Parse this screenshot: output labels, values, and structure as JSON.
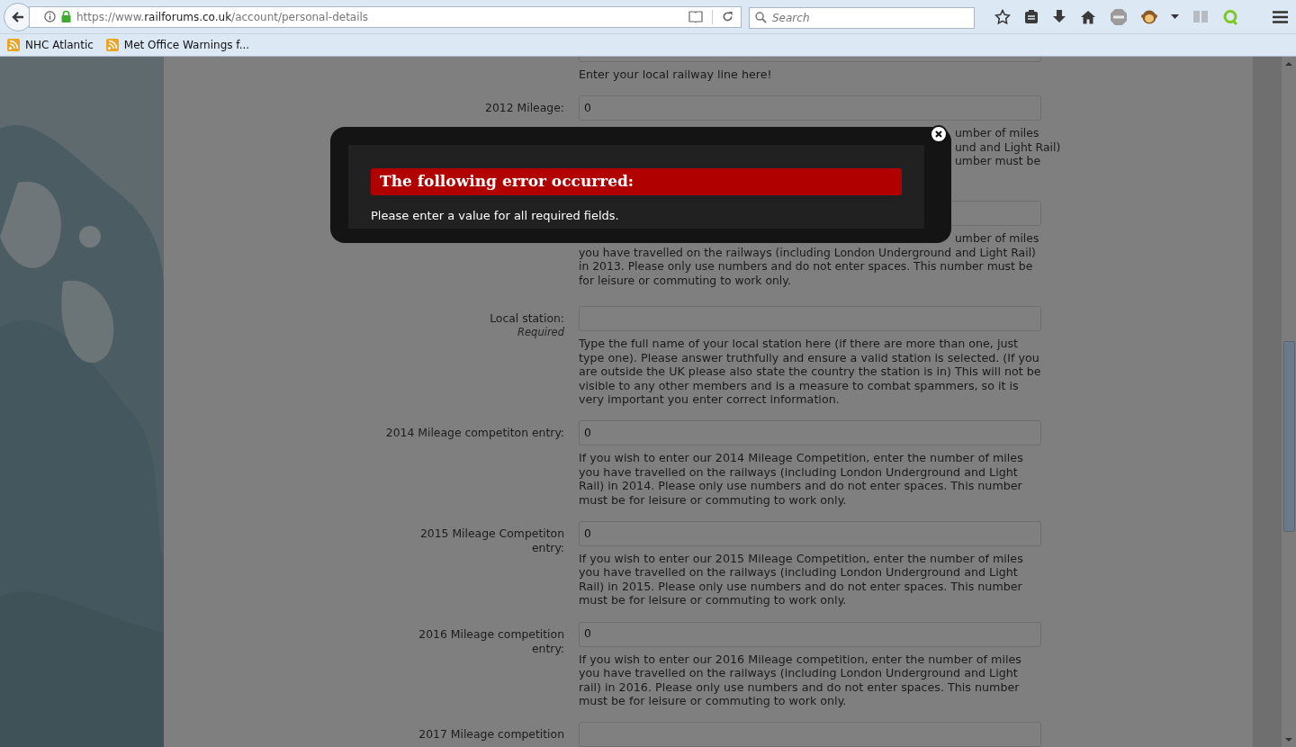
{
  "browser": {
    "url_scheme": "https://www.",
    "url_domain": "railforums.co.uk",
    "url_path": "/account/personal-details",
    "search_placeholder": "Search",
    "bookmarks": [
      {
        "label": "NHC Atlantic"
      },
      {
        "label": "Met Office Warnings f..."
      }
    ]
  },
  "form": {
    "rows": [
      {
        "help": "Enter your local railway line here!"
      },
      {
        "label": "2012 Mileage:",
        "value": "0",
        "help_lines": [
          {
            "kind": "tail",
            "text": "umber of miles"
          },
          {
            "kind": "tail",
            "text": "und and Light Rail)"
          },
          {
            "kind": "tail",
            "text": "umber must be"
          }
        ]
      },
      {
        "help_lines": [
          {
            "kind": "tail",
            "text": "umber of miles"
          },
          {
            "kind": "full",
            "text": "you have travelled on the railways (including London Underground and Light Rail)"
          },
          {
            "kind": "full",
            "text": "in 2013. Please only use numbers and do not enter spaces. This number must be"
          },
          {
            "kind": "full",
            "text": "for leisure or commuting to work only."
          }
        ]
      },
      {
        "label": "Local station:",
        "note": "Required",
        "value": "",
        "help": "Type the full name of your local station here (if there are more than one, just type one). Please answer truthfully and ensure a valid station is selected. (If you are outside the UK please also state the country the station is in) This will not be visible to any other members and is a measure to combat spammers, so it is very important you enter correct information."
      },
      {
        "label": "2014 Mileage competiton entry:",
        "value": "0",
        "help": "If you wish to enter our 2014 Mileage Competition, enter the number of miles you have travelled on the railways (including London Underground and Light Rail) in 2014. Please only use numbers and do not enter spaces. This number must be for leisure or commuting to work only."
      },
      {
        "label": "2015 Mileage Competiton entry:",
        "value": "0",
        "help": "If you wish to enter our 2015 Mileage Competition, enter the number of miles you have travelled on the railways (including London Underground and Light Rail) in 2015. Please only use numbers and do not enter spaces. This number must be for leisure or commuting to work only."
      },
      {
        "label": "2016 Mileage competition entry:",
        "value": "0",
        "help": "If you wish to enter our 2016 Mileage competition, enter the number of miles you have travelled on the railways (including London Underground and Light rail) in 2016. Please only use numbers and do not enter spaces. This number must be for leisure or commuting to work only."
      },
      {
        "label": "2017 Mileage competition",
        "value": ""
      }
    ]
  },
  "modal": {
    "title": "The following error occurred:",
    "message": "Please enter a value for all required fields."
  }
}
